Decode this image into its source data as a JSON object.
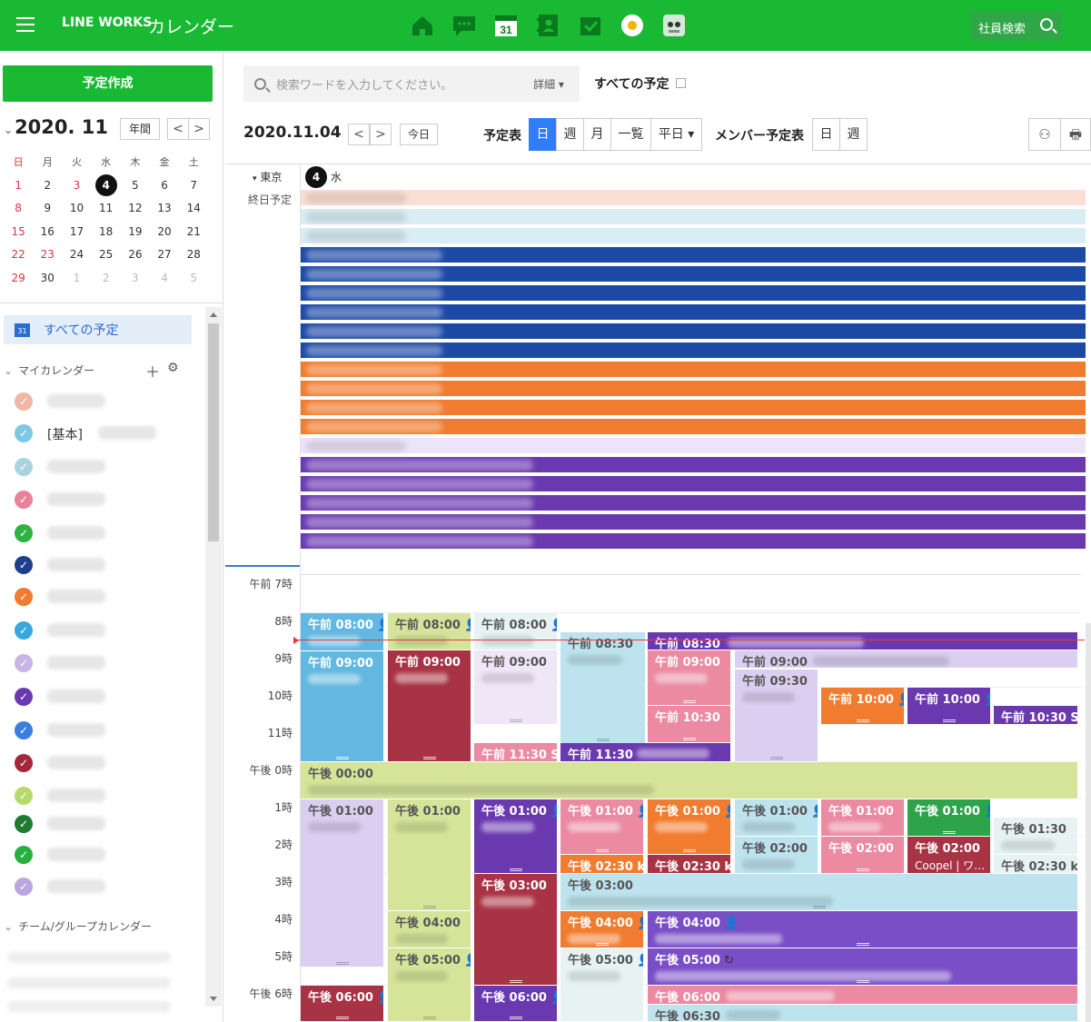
{
  "header": {
    "logo": "LINE WORKS",
    "app_name": "カレンダー",
    "employee_search": "社員検索",
    "app_icons": [
      "home-icon",
      "talk-icon",
      "calendar-icon",
      "contacts-icon",
      "mail-icon",
      "bot-icon",
      "character-icon"
    ],
    "calendar_icon_day": "31"
  },
  "sidebar": {
    "create_label": "予定作成",
    "mini_title": "2020. 11",
    "year_label": "年間",
    "prev": "<",
    "next": ">",
    "weekdays": [
      "日",
      "月",
      "火",
      "水",
      "木",
      "金",
      "土"
    ],
    "weeks": [
      [
        "1",
        "2",
        "3",
        "4",
        "5",
        "6",
        "7"
      ],
      [
        "8",
        "9",
        "10",
        "11",
        "12",
        "13",
        "14"
      ],
      [
        "15",
        "16",
        "17",
        "18",
        "19",
        "20",
        "21"
      ],
      [
        "22",
        "23",
        "24",
        "25",
        "26",
        "27",
        "28"
      ],
      [
        "29",
        "30",
        "1",
        "2",
        "3",
        "4",
        "5"
      ]
    ],
    "all_schedules": "すべての予定",
    "all_schedules_icon_day": "31",
    "my_calendar": "マイカレンダー",
    "basic_label": "[基本]",
    "my_calendar_colors": [
      "#efb8a5",
      "#7ec8e3",
      "#a9d4dd",
      "#e8829a",
      "#30b143",
      "#1d3f8c",
      "#f17b2e",
      "#39a7dd",
      "#c9b4e6",
      "#6a39b0",
      "#3a7ee0",
      "#a4283a",
      "#b7d86a",
      "#1f7b34",
      "#27b03d",
      "#bba6e0"
    ],
    "team_calendar": "チーム/グループカレンダー"
  },
  "toolbar": {
    "search_placeholder": "検索ワードを入力してください。",
    "detail": "詳細",
    "all_filter": "すべての予定",
    "current_date": "2020.11.04",
    "prev": "<",
    "next": ">",
    "today": "今日",
    "view_label": "予定表",
    "views": [
      "日",
      "週",
      "月",
      "一覧",
      "平日"
    ],
    "member_label": "メンバー予定表",
    "member_views": [
      "日",
      "週"
    ]
  },
  "day_header": {
    "timezone": "東京",
    "day_num": "4",
    "weekday": "水",
    "allday_label": "終日予定"
  },
  "colors": {
    "green": "#19b933",
    "accent_blue": "#2f7ef7",
    "allday_bars": [
      "#fbdfd6",
      "#d9eef4",
      "#d9eef4",
      "#1d49a6",
      "#1d49a6",
      "#1d49a6",
      "#1d49a6",
      "#1d49a6",
      "#1d49a6",
      "#f17b2e",
      "#f17b2e",
      "#f17b2e",
      "#f17b2e",
      "#ece4f8",
      "#6a39b0",
      "#6a39b0",
      "#6a39b0",
      "#6a39b0",
      "#6a39b0"
    ]
  },
  "hours": [
    "午前  7時",
    "8時",
    "9時",
    "10時",
    "11時",
    "午後  0時",
    "1時",
    "2時",
    "3時",
    "4時",
    "5時",
    "午後  6時"
  ],
  "events": {
    "e1": "午前 08:00",
    "e2": "午前 08:00",
    "e3": "午前 08:00",
    "e4": "午前 08:30",
    "e5": "午前 08:30",
    "e6": "午前 09:00",
    "e7": "午前 09:00",
    "e8": "午前 09:00",
    "e9": "午前 09:00",
    "e10": "午前 09:00",
    "e11": "午前 09:30",
    "e12": "午前 10:00",
    "e13": "午前 10:00",
    "e14": "午前 10:30",
    "e15": "午前 10:30 Sc",
    "e16": "午前 11:30 St",
    "e17": "午前 11:30",
    "e18": "午後 00:00",
    "e19": "午後 01:00",
    "e20": "午後 01:00",
    "e21": "午後 01:00",
    "e22": "午後 01:00",
    "e23": "午後 01:00",
    "e24": "午後 01:00",
    "e25": "午後 01:00",
    "e26": "午後 01:00",
    "e27": "午後 01:30",
    "e28": "午後 02:00",
    "e29": "午後 02:00",
    "e30": "午後 02:00",
    "e30_sub": "Coopel | ワ…",
    "e31": "午後 02:30 ki",
    "e32": "午後 02:30 ki",
    "e33": "午後 02:30 ki",
    "e34": "午後 03:00",
    "e35": "午後 03:00",
    "e36": "午後 04:00",
    "e37": "午後 04:00",
    "e38": "午後 04:00",
    "e39": "午後 05:00",
    "e40": "午後 05:00",
    "e41": "午後 05:00",
    "e42": "午後 06:00",
    "e43": "午後 06:00",
    "e44": "午後 06:00",
    "e45": "午後 06:30"
  }
}
